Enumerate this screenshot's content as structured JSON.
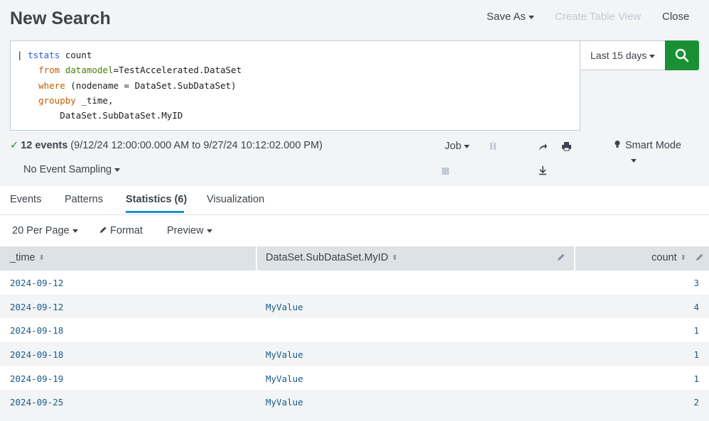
{
  "header": {
    "title": "New Search",
    "save_as": "Save As",
    "create_table_view": "Create Table View",
    "close": "Close"
  },
  "search": {
    "lines": [
      {
        "pipe": "| ",
        "kw": "tstats",
        "kw_color": "blue",
        "rest": " count"
      },
      {
        "indent": "    ",
        "kw": "from",
        "kw_color": "orange",
        "arg": "datamodel",
        "rest": "=TestAccelerated.DataSet"
      },
      {
        "indent": "    ",
        "kw": "where",
        "kw_color": "orange",
        "rest": " (nodename = DataSet.SubDataSet)"
      },
      {
        "indent": "    ",
        "kw": "groupby",
        "kw_color": "orange",
        "rest": " _time,"
      },
      {
        "indent": "        ",
        "rest": "DataSet.SubDataSet.MyID"
      }
    ],
    "time_range": "Last 15 days",
    "search_icon": "magnifier-icon"
  },
  "status": {
    "count": "12 events",
    "range": "(9/12/24 12:00:00.000 AM to 9/27/24 10:12:02.000 PM)",
    "sampling": "No Event Sampling",
    "job": "Job",
    "mode": "Smart Mode"
  },
  "tabs": [
    {
      "label": "Events"
    },
    {
      "label": "Patterns"
    },
    {
      "label": "Statistics (6)",
      "active": true
    },
    {
      "label": "Visualization"
    }
  ],
  "toolbar": {
    "per_page": "20 Per Page",
    "format": "Format",
    "preview": "Preview"
  },
  "table": {
    "columns": [
      "_time",
      "DataSet.SubDataSet.MyID",
      "count"
    ],
    "rows": [
      [
        "2024-09-12",
        "",
        "3"
      ],
      [
        "2024-09-12",
        "MyValue",
        "4"
      ],
      [
        "2024-09-18",
        "",
        "1"
      ],
      [
        "2024-09-18",
        "MyValue",
        "1"
      ],
      [
        "2024-09-19",
        "MyValue",
        "1"
      ],
      [
        "2024-09-25",
        "MyValue",
        "2"
      ]
    ]
  },
  "colors": {
    "accent_green": "#1a9035",
    "tab_underline": "#1e93c6",
    "link_value": "#1a5c8c"
  }
}
